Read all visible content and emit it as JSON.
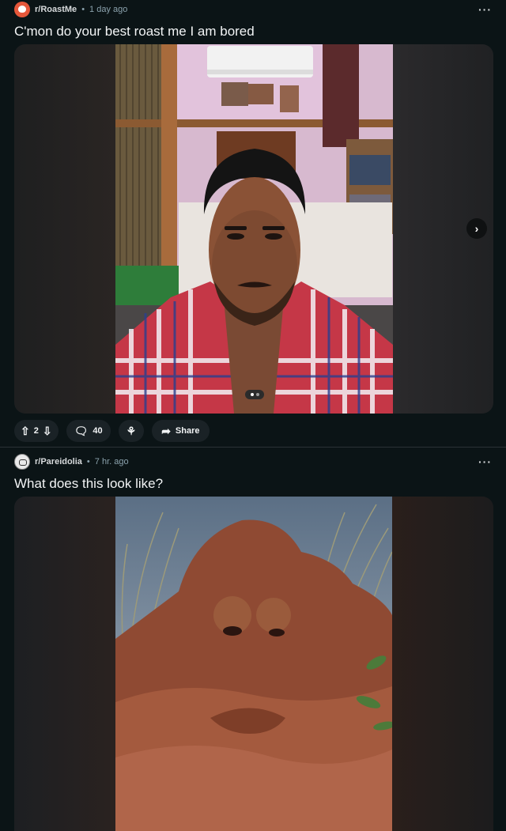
{
  "posts": [
    {
      "subreddit": "r/RoastMe",
      "separator": "•",
      "time": "1 day ago",
      "more_label": "···",
      "title": "C'mon do your best roast me I am bored",
      "votes": "2",
      "comments": "40",
      "share_label": "Share",
      "gallery": {
        "current": 1,
        "total": 2
      },
      "icons": [
        "roastme-avatar-icon",
        "upvote-icon",
        "downvote-icon",
        "comment-icon",
        "award-icon",
        "share-icon",
        "chevron-right-icon"
      ]
    },
    {
      "subreddit": "r/Pareidolia",
      "separator": "•",
      "time": "7 hr. ago",
      "more_label": "···",
      "title": "What does this look like?",
      "icons": [
        "pareidolia-avatar-icon"
      ]
    }
  ],
  "colors": {
    "background": "#0b1416",
    "pill": "#1a2226",
    "accent": "#e6573a"
  }
}
